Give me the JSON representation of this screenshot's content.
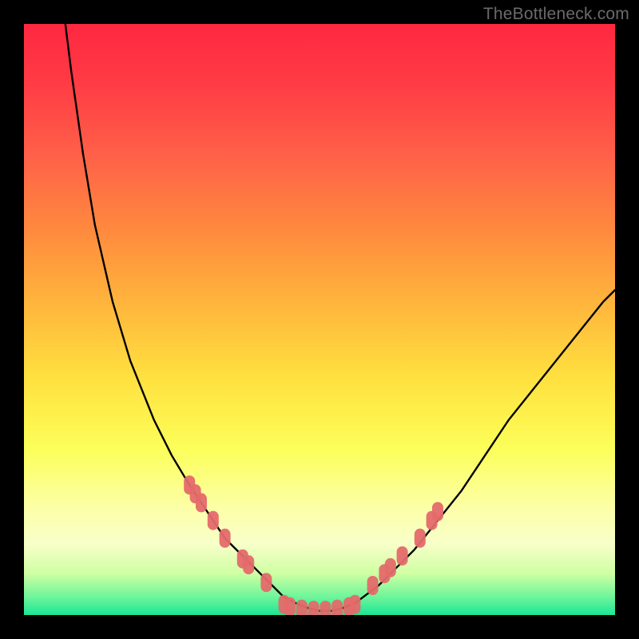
{
  "attribution": "TheBottleneck.com",
  "colors": {
    "frame": "#000000",
    "curve": "#000000",
    "marker": "#e46a6a",
    "gradient_stops": [
      "#ff2840",
      "#ff3b45",
      "#ff6048",
      "#ff8a3e",
      "#ffb43c",
      "#ffe13f",
      "#fcff5a",
      "#fcffa8",
      "#f8ffc9",
      "#ceffa2",
      "#6cf59a",
      "#1be695"
    ]
  },
  "chart_data": {
    "type": "line",
    "title": "",
    "xlabel": "",
    "ylabel": "",
    "xlim": [
      0,
      100
    ],
    "ylim": [
      0,
      100
    ],
    "legend": false,
    "grid": false,
    "series": [
      {
        "name": "bottleneck-curve",
        "x": [
          7,
          8,
          10,
          12,
          15,
          18,
          22,
          25,
          28,
          30,
          32,
          34,
          36,
          38,
          40,
          42,
          43,
          44,
          46,
          48,
          50,
          52,
          54,
          56,
          58,
          60,
          63,
          66,
          70,
          74,
          78,
          82,
          86,
          90,
          94,
          98,
          100
        ],
        "y": [
          100,
          92,
          78,
          66,
          53,
          43,
          33,
          27,
          22,
          19,
          16,
          13,
          11,
          9,
          7,
          5,
          4,
          3,
          2,
          1.2,
          0.7,
          0.7,
          1.2,
          2,
          3.5,
          5,
          8,
          11,
          16,
          21,
          27,
          33,
          38,
          43,
          48,
          53,
          55
        ]
      }
    ],
    "markers": [
      {
        "name": "left-cluster",
        "x": 28,
        "y": 22
      },
      {
        "name": "left-cluster",
        "x": 29,
        "y": 20.5
      },
      {
        "name": "left-cluster",
        "x": 30,
        "y": 19
      },
      {
        "name": "left-cluster",
        "x": 32,
        "y": 16
      },
      {
        "name": "left-cluster",
        "x": 34,
        "y": 13
      },
      {
        "name": "left-cluster",
        "x": 37,
        "y": 9.5
      },
      {
        "name": "left-cluster",
        "x": 38,
        "y": 8.5
      },
      {
        "name": "left-cluster",
        "x": 41,
        "y": 5.5
      },
      {
        "name": "bottom-cluster",
        "x": 44,
        "y": 1.8
      },
      {
        "name": "bottom-cluster",
        "x": 45,
        "y": 1.4
      },
      {
        "name": "bottom-cluster",
        "x": 47,
        "y": 1.0
      },
      {
        "name": "bottom-cluster",
        "x": 49,
        "y": 0.8
      },
      {
        "name": "bottom-cluster",
        "x": 51,
        "y": 0.8
      },
      {
        "name": "bottom-cluster",
        "x": 53,
        "y": 1.0
      },
      {
        "name": "bottom-cluster",
        "x": 55,
        "y": 1.4
      },
      {
        "name": "bottom-cluster",
        "x": 56,
        "y": 1.8
      },
      {
        "name": "right-cluster",
        "x": 59,
        "y": 5
      },
      {
        "name": "right-cluster",
        "x": 61,
        "y": 7
      },
      {
        "name": "right-cluster",
        "x": 62,
        "y": 8
      },
      {
        "name": "right-cluster",
        "x": 64,
        "y": 10
      },
      {
        "name": "right-cluster",
        "x": 67,
        "y": 13
      },
      {
        "name": "right-cluster",
        "x": 69,
        "y": 16
      },
      {
        "name": "right-cluster",
        "x": 70,
        "y": 17.5
      }
    ]
  }
}
